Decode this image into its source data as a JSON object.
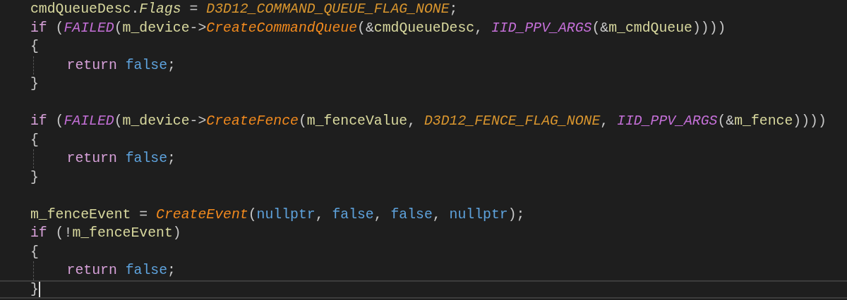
{
  "editor": {
    "lines": [
      {
        "kind": "code",
        "current": false,
        "tokens": [
          {
            "text": "cmdQueueDesc",
            "kind": "variable"
          },
          {
            "text": ".",
            "kind": "punct"
          },
          {
            "text": "Flags",
            "kind": "member"
          },
          {
            "text": " = ",
            "kind": "punct"
          },
          {
            "text": "D3D12_COMMAND_QUEUE_FLAG_NONE",
            "kind": "constant"
          },
          {
            "text": ";",
            "kind": "punct"
          }
        ]
      },
      {
        "kind": "code",
        "current": false,
        "tokens": [
          {
            "text": "if",
            "kind": "keyword"
          },
          {
            "text": " (",
            "kind": "punct"
          },
          {
            "text": "FAILED",
            "kind": "macro"
          },
          {
            "text": "(",
            "kind": "punct"
          },
          {
            "text": "m_device",
            "kind": "variable"
          },
          {
            "text": "->",
            "kind": "punct"
          },
          {
            "text": "CreateCommandQueue",
            "kind": "function"
          },
          {
            "text": "(&",
            "kind": "punct"
          },
          {
            "text": "cmdQueueDesc",
            "kind": "variable"
          },
          {
            "text": ", ",
            "kind": "punct"
          },
          {
            "text": "IID_PPV_ARGS",
            "kind": "macro"
          },
          {
            "text": "(&",
            "kind": "punct"
          },
          {
            "text": "m_cmdQueue",
            "kind": "variable"
          },
          {
            "text": "))))",
            "kind": "punct"
          }
        ]
      },
      {
        "kind": "code",
        "current": false,
        "tokens": [
          {
            "text": "{",
            "kind": "punct"
          }
        ]
      },
      {
        "kind": "code",
        "current": false,
        "indent_guide": true,
        "tokens": [
          {
            "text": "return",
            "kind": "keyword"
          },
          {
            "text": " false",
            "kind": "bool"
          },
          {
            "text": ";",
            "kind": "punct"
          }
        ]
      },
      {
        "kind": "code",
        "current": false,
        "tokens": [
          {
            "text": "}",
            "kind": "punct"
          }
        ]
      },
      {
        "kind": "blank",
        "current": false
      },
      {
        "kind": "code",
        "current": false,
        "tokens": [
          {
            "text": "if",
            "kind": "keyword"
          },
          {
            "text": " (",
            "kind": "punct"
          },
          {
            "text": "FAILED",
            "kind": "macro"
          },
          {
            "text": "(",
            "kind": "punct"
          },
          {
            "text": "m_device",
            "kind": "variable"
          },
          {
            "text": "->",
            "kind": "punct"
          },
          {
            "text": "CreateFence",
            "kind": "function"
          },
          {
            "text": "(",
            "kind": "punct"
          },
          {
            "text": "m_fenceValue",
            "kind": "variable"
          },
          {
            "text": ", ",
            "kind": "punct"
          },
          {
            "text": "D3D12_FENCE_FLAG_NONE",
            "kind": "constant"
          },
          {
            "text": ", ",
            "kind": "punct"
          },
          {
            "text": "IID_PPV_ARGS",
            "kind": "macro"
          },
          {
            "text": "(&",
            "kind": "punct"
          },
          {
            "text": "m_fence",
            "kind": "variable"
          },
          {
            "text": "))))",
            "kind": "punct"
          }
        ]
      },
      {
        "kind": "code",
        "current": false,
        "tokens": [
          {
            "text": "{",
            "kind": "punct"
          }
        ]
      },
      {
        "kind": "code",
        "current": false,
        "indent_guide": true,
        "tokens": [
          {
            "text": "return",
            "kind": "keyword"
          },
          {
            "text": " false",
            "kind": "bool"
          },
          {
            "text": ";",
            "kind": "punct"
          }
        ]
      },
      {
        "kind": "code",
        "current": false,
        "tokens": [
          {
            "text": "}",
            "kind": "punct"
          }
        ]
      },
      {
        "kind": "blank",
        "current": false
      },
      {
        "kind": "code",
        "current": false,
        "tokens": [
          {
            "text": "m_fenceEvent",
            "kind": "variable"
          },
          {
            "text": " = ",
            "kind": "punct"
          },
          {
            "text": "CreateEvent",
            "kind": "function"
          },
          {
            "text": "(",
            "kind": "punct"
          },
          {
            "text": "nullptr",
            "kind": "bool"
          },
          {
            "text": ", ",
            "kind": "punct"
          },
          {
            "text": "false",
            "kind": "bool"
          },
          {
            "text": ", ",
            "kind": "punct"
          },
          {
            "text": "false",
            "kind": "bool"
          },
          {
            "text": ", ",
            "kind": "punct"
          },
          {
            "text": "nullptr",
            "kind": "bool"
          },
          {
            "text": ");",
            "kind": "punct"
          }
        ]
      },
      {
        "kind": "code",
        "current": false,
        "tokens": [
          {
            "text": "if",
            "kind": "keyword"
          },
          {
            "text": " (!",
            "kind": "punct"
          },
          {
            "text": "m_fenceEvent",
            "kind": "variable"
          },
          {
            "text": ")",
            "kind": "punct"
          }
        ]
      },
      {
        "kind": "code",
        "current": false,
        "tokens": [
          {
            "text": "{",
            "kind": "punct"
          }
        ]
      },
      {
        "kind": "code",
        "current": false,
        "indent_guide": true,
        "tokens": [
          {
            "text": "return",
            "kind": "keyword"
          },
          {
            "text": " false",
            "kind": "bool"
          },
          {
            "text": ";",
            "kind": "punct"
          }
        ]
      },
      {
        "kind": "code",
        "current": true,
        "tokens": [
          {
            "text": "}",
            "kind": "punct"
          }
        ]
      }
    ]
  }
}
